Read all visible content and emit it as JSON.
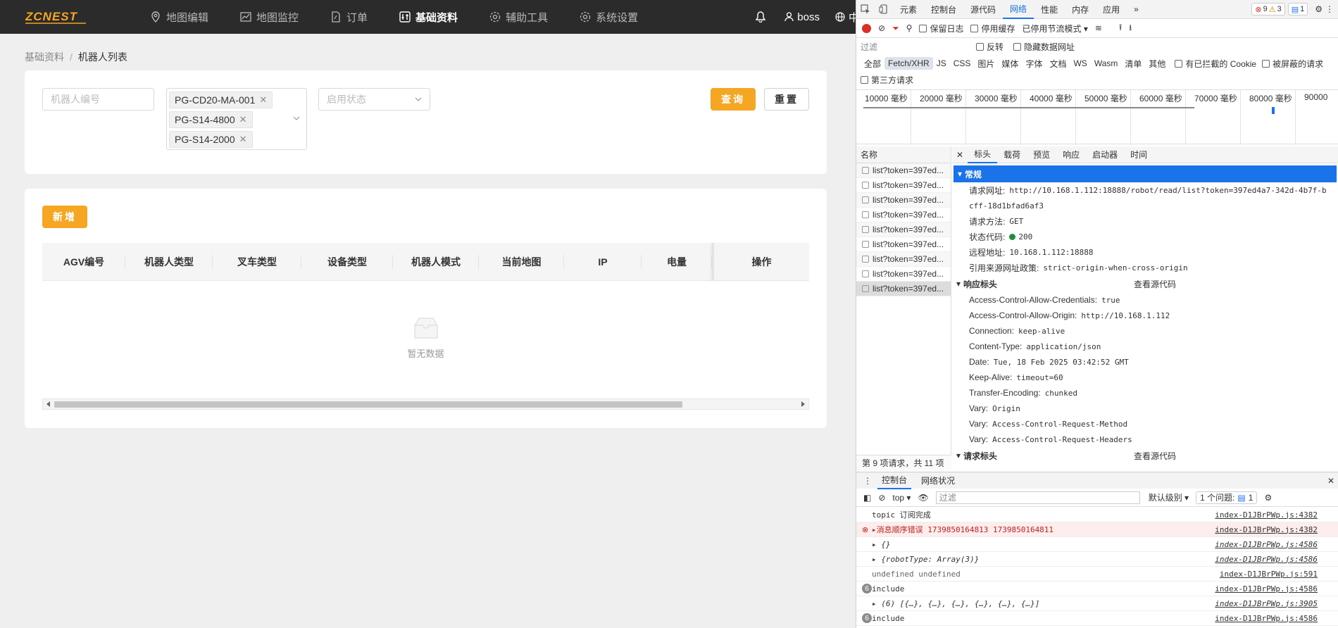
{
  "app": {
    "logo_text": "ZCNEST",
    "nav": [
      {
        "label": "地图编辑",
        "icon": "map-pin-icon"
      },
      {
        "label": "地图监控",
        "icon": "chart-line-icon"
      },
      {
        "label": "订单",
        "icon": "document-icon"
      },
      {
        "label": "基础资料",
        "icon": "sliders-icon",
        "active": true
      },
      {
        "label": "辅助工具",
        "icon": "gear-icon"
      },
      {
        "label": "系统设置",
        "icon": "gear-icon"
      }
    ],
    "user": "boss",
    "language": "中文",
    "breadcrumb": {
      "parent": "基础资料",
      "separator": "/",
      "current": "机器人列表"
    },
    "search": {
      "robot_no_placeholder": "机器人编号",
      "type_tags": [
        "PG-CD20-MA-001",
        "PG-S14-4800",
        "PG-S14-2000"
      ],
      "status_placeholder": "启用状态",
      "query_label": "查询",
      "reset_label": "重置"
    },
    "add_label": "新增",
    "table": {
      "columns": [
        "AGV编号",
        "机器人类型",
        "叉车类型",
        "设备类型",
        "机器人模式",
        "当前地图",
        "IP",
        "电量",
        "操作"
      ],
      "empty_text": "暂无数据"
    },
    "colors": {
      "accent": "#f5a623",
      "topbar": "#2b2b2b"
    }
  },
  "devtools": {
    "tabs": [
      "元素",
      "控制台",
      "源代码",
      "网络",
      "性能",
      "内存",
      "应用"
    ],
    "active_tab": "网络",
    "error_count": "9",
    "warning_count": "3",
    "info_count": "1",
    "toolbar": {
      "preserve_log": "保留日志",
      "disable_cache": "停用缓存",
      "throttle": "已停用节流模式"
    },
    "filter": {
      "placeholder": "过滤",
      "invert": "反转",
      "hide_data_urls": "隐藏数据网址"
    },
    "types": [
      "全部",
      "Fetch/XHR",
      "JS",
      "CSS",
      "图片",
      "媒体",
      "字体",
      "文档",
      "WS",
      "Wasm",
      "清单",
      "其他"
    ],
    "blocked_cookies": "有已拦截的 Cookie",
    "blocked_requests": "被屏蔽的请求",
    "third_party": "第三方请求",
    "timeline_labels": [
      "10000 毫秒",
      "20000 毫秒",
      "30000 毫秒",
      "40000 毫秒",
      "50000 毫秒",
      "60000 毫秒",
      "70000 毫秒",
      "80000 毫秒",
      "90000"
    ],
    "name_header": "名称",
    "requests": [
      "list?token=397ed...",
      "list?token=397ed...",
      "list?token=397ed...",
      "list?token=397ed...",
      "list?token=397ed...",
      "list?token=397ed...",
      "list?token=397ed...",
      "list?token=397ed...",
      "list?token=397ed..."
    ],
    "request_footer": "第 9 项请求，共 11 项",
    "detail_tabs": [
      "标头",
      "载荷",
      "预览",
      "响应",
      "启动器",
      "时间"
    ],
    "general_title": "常规",
    "general": [
      {
        "k": "请求网址:",
        "v": "http://10.168.1.112:18888/robot/read/list?token=397ed4a7-342d-4b7f-b"
      },
      {
        "k": "",
        "v": "cff-18d1bfad6af3"
      },
      {
        "k": "请求方法:",
        "v": "GET"
      },
      {
        "k": "状态代码:",
        "v": "200"
      },
      {
        "k": "远程地址:",
        "v": "10.168.1.112:18888"
      },
      {
        "k": "引用来源网址政策:",
        "v": "strict-origin-when-cross-origin"
      }
    ],
    "response_title": "响应标头",
    "view_source": "查看源代码",
    "response_headers": [
      {
        "k": "Access-Control-Allow-Credentials:",
        "v": "true"
      },
      {
        "k": "Access-Control-Allow-Origin:",
        "v": "http://10.168.1.112"
      },
      {
        "k": "Connection:",
        "v": "keep-alive"
      },
      {
        "k": "Content-Type:",
        "v": "application/json"
      },
      {
        "k": "Date:",
        "v": "Tue, 18 Feb 2025 03:42:52 GMT"
      },
      {
        "k": "Keep-Alive:",
        "v": "timeout=60"
      },
      {
        "k": "Transfer-Encoding:",
        "v": "chunked"
      },
      {
        "k": "Vary:",
        "v": "Origin"
      },
      {
        "k": "Vary:",
        "v": "Access-Control-Request-Method"
      },
      {
        "k": "Vary:",
        "v": "Access-Control-Request-Headers"
      }
    ],
    "request_title": "请求标头",
    "console_tabs": [
      "控制台",
      "网络状况"
    ],
    "console_context": "top",
    "console_filter": "过滤",
    "console_level": "默认级别",
    "console_issues": "1 个问题:",
    "console_issue_count": "1",
    "logs": [
      {
        "text": "topic 订阅完成",
        "src": "index-D1JBrPWp.js:4382",
        "kind": "plain"
      },
      {
        "text": "▸消息顺序错误  1739850164813 1739850164811",
        "src": "index-D1JBrPWp.js:4382",
        "kind": "err"
      },
      {
        "text": "▸ {}",
        "src": "index-D1JBrPWp.js:4586",
        "kind": "it"
      },
      {
        "text": "▸ {robotType: Array(3)}",
        "src": "index-D1JBrPWp.js:4586",
        "kind": "it"
      },
      {
        "text": "undefined undefined",
        "src": "index-D1JBrPWp.js:591",
        "kind": "muted"
      },
      {
        "text": "include",
        "src": "index-D1JBrPWp.js:4586",
        "kind": "count",
        "count": "6"
      },
      {
        "text": "▸ (6) [{…}, {…}, {…}, {…}, {…}, {…}]",
        "src": "index-D1JBrPWp.js:3905",
        "kind": "it"
      },
      {
        "text": "include",
        "src": "index-D1JBrPWp.js:4586",
        "kind": "count",
        "count": "6"
      }
    ]
  }
}
